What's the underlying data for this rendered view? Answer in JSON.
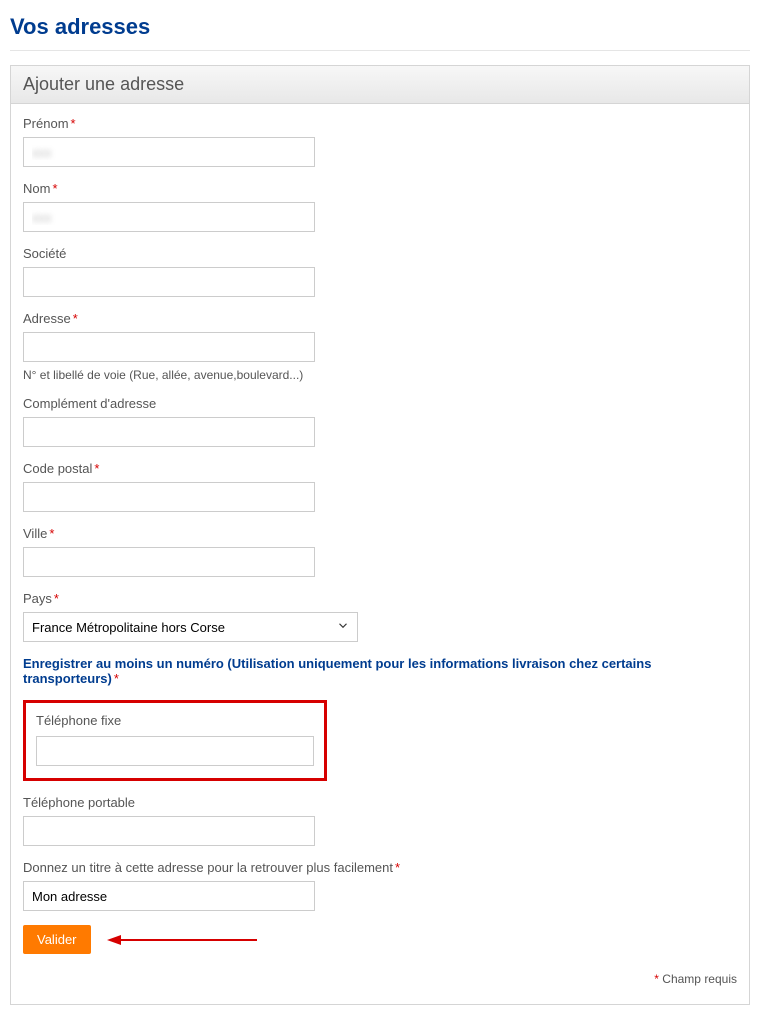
{
  "page": {
    "title": "Vos adresses",
    "panelTitle": "Ajouter une adresse"
  },
  "fields": {
    "firstName": {
      "label": "Prénom",
      "value": "xxx"
    },
    "lastName": {
      "label": "Nom",
      "value": "xxx"
    },
    "company": {
      "label": "Société",
      "value": ""
    },
    "address": {
      "label": "Adresse",
      "value": "",
      "hint": "N° et libellé de voie (Rue, allée, avenue,boulevard...)"
    },
    "addressComplement": {
      "label": "Complément d'adresse",
      "value": ""
    },
    "postalCode": {
      "label": "Code postal",
      "value": ""
    },
    "city": {
      "label": "Ville",
      "value": ""
    },
    "country": {
      "label": "Pays",
      "value": "France Métropolitaine hors Corse"
    },
    "phoneNote": "Enregistrer au moins un numéro (Utilisation uniquement pour les informations livraison chez certains transporteurs)",
    "phoneFixed": {
      "label": "Téléphone fixe",
      "value": ""
    },
    "phoneMobile": {
      "label": "Téléphone portable",
      "value": ""
    },
    "addressTitle": {
      "label": "Donnez un titre à cette adresse pour la retrouver plus facilement",
      "value": "Mon adresse"
    }
  },
  "buttons": {
    "submit": "Valider"
  },
  "footer": {
    "requiredNote": "Champ requis"
  }
}
